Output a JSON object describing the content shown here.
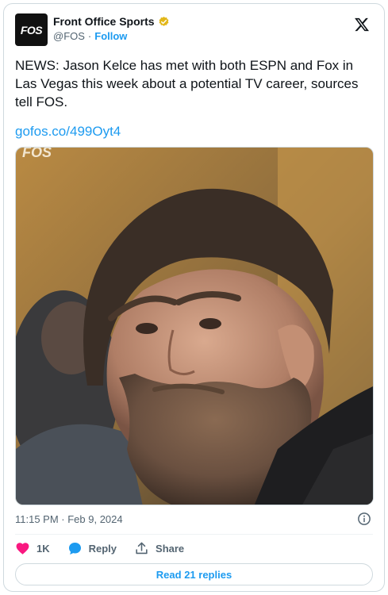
{
  "account": {
    "avatar_text": "FOS",
    "display_name": "Front Office Sports",
    "handle": "@FOS",
    "separator": "·",
    "follow_label": "Follow"
  },
  "tweet": {
    "text": "NEWS: Jason Kelce has met with both ESPN and Fox in Las Vegas this week about a potential TV career, sources tell FOS.",
    "link": "gofos.co/499Oyt4",
    "image_watermark": "FOS",
    "timestamp": "11:15 PM · Feb 9, 2024"
  },
  "actions": {
    "likes_count": "1K",
    "reply_label": "Reply",
    "share_label": "Share"
  },
  "footer": {
    "read_replies_label": "Read 21 replies"
  },
  "colors": {
    "accent": "#1d9bf0",
    "like": "#f91880",
    "verified_gold": "#e2b719"
  }
}
